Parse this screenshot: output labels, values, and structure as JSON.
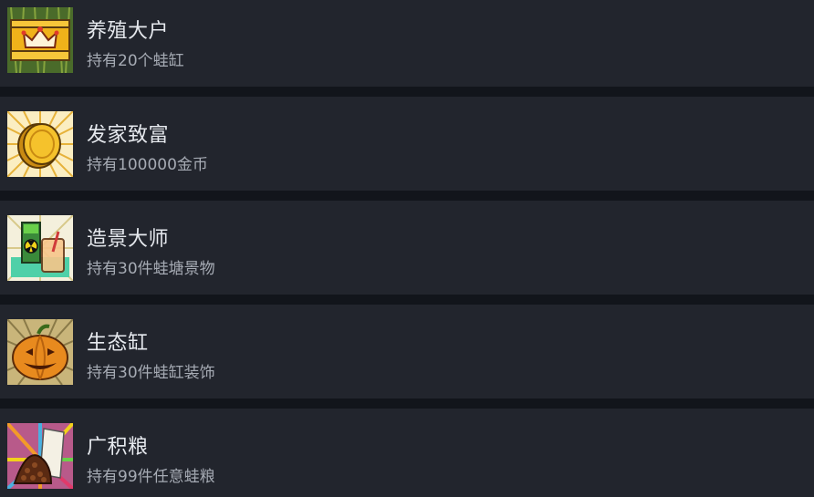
{
  "achievements": [
    {
      "title": "养殖大户",
      "description": "持有20个蛙缸",
      "icon": "crown-chest-icon"
    },
    {
      "title": "发家致富",
      "description": "持有100000金币",
      "icon": "gold-coin-icon"
    },
    {
      "title": "造景大师",
      "description": "持有30件蛙塘景物",
      "icon": "aquarium-decor-icon"
    },
    {
      "title": "生态缸",
      "description": "持有30件蛙缸装饰",
      "icon": "pumpkin-icon"
    },
    {
      "title": "广积粮",
      "description": "持有99件任意蛙粮",
      "icon": "food-pile-icon"
    }
  ]
}
